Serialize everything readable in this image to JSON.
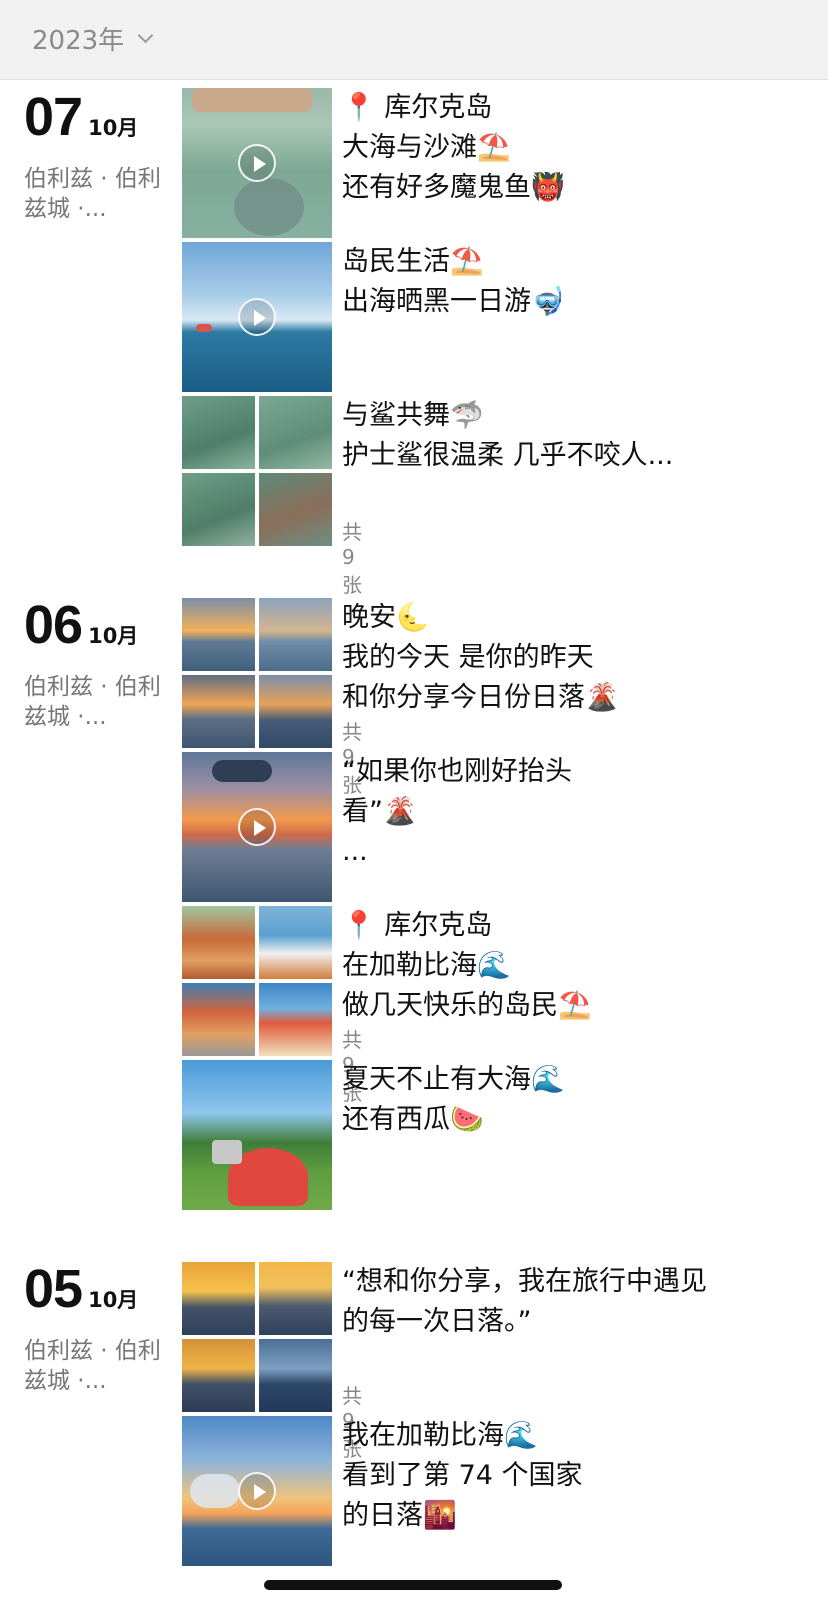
{
  "header": {
    "year": "2023年"
  },
  "days": [
    {
      "day": "07",
      "month": "10月",
      "location": "伯利兹 · 伯利兹城 ·..."
    },
    {
      "day": "06",
      "month": "10月",
      "location": "伯利兹 · 伯利兹城 ·..."
    },
    {
      "day": "05",
      "month": "10月",
      "location": "伯利兹 · 伯利兹城 ·..."
    }
  ],
  "posts": [
    {
      "lines": [
        "📍 库尔克岛",
        "大海与沙滩⛱️",
        "还有好多魔鬼鱼👹"
      ]
    },
    {
      "lines": [
        "岛民生活⛱️",
        "出海晒黑一日游🤿"
      ]
    },
    {
      "lines": [
        "与鲨共舞🦈",
        "",
        "护士鲨很温柔 几乎不咬人..."
      ],
      "count": "共9张"
    },
    {
      "lines": [
        "晚安🌜",
        "我的今天 是你的昨天",
        "和你分享今日份日落🌋"
      ],
      "count": "共9张"
    },
    {
      "lines": [
        "“如果你也刚好抬头",
        "看”🌋",
        "..."
      ]
    },
    {
      "lines": [
        "📍 库尔克岛",
        "在加勒比海🌊",
        "做几天快乐的岛民⛱️"
      ],
      "count": "共9张"
    },
    {
      "lines": [
        "夏天不止有大海🌊",
        "还有西瓜🍉"
      ]
    },
    {
      "lines": [
        "“想和你分享，我在旅行中遇见",
        "的每一次日落。”"
      ],
      "count": "共9张"
    },
    {
      "lines": [
        "我在加勒比海🌊",
        "看到了第 74 个国家",
        "的日落🌇"
      ]
    }
  ]
}
